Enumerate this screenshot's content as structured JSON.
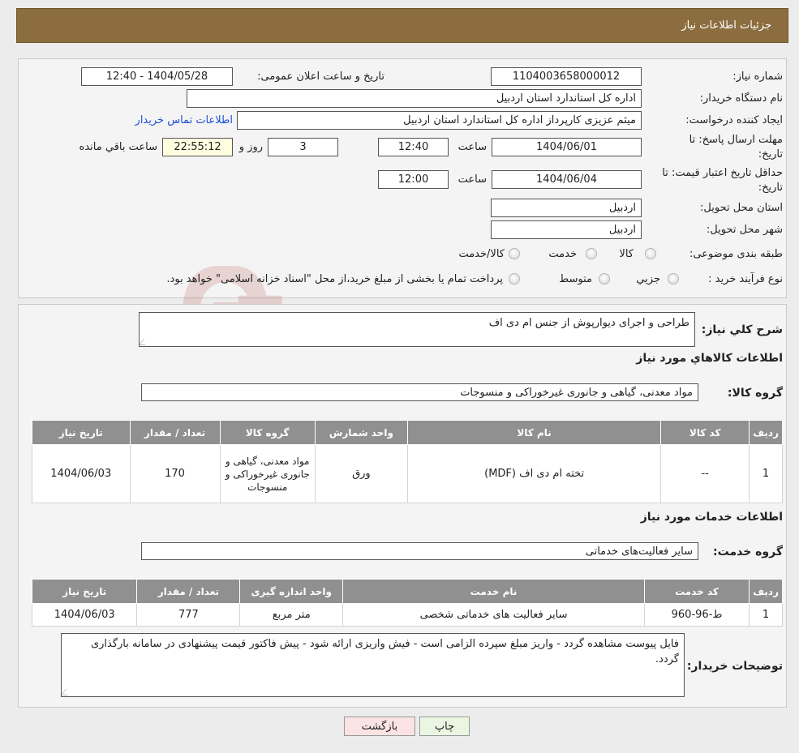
{
  "header": {
    "title": "جزئیات اطلاعات نیاز"
  },
  "form": {
    "need_number_label": "شماره نیاز:",
    "need_number": "1104003658000012",
    "announce_label": "تاریخ و ساعت اعلان عمومی:",
    "announce_value": "1404/05/28 - 12:40",
    "buyer_org_label": "نام دستگاه خریدار:",
    "buyer_org": "اداره کل استاندارد استان اردبیل",
    "creator_label": "ایجاد کننده درخواست:",
    "creator": "میثم عزیزی کارپرداز اداره کل استاندارد استان اردبیل",
    "contact_link": "اطلاعات تماس خریدار",
    "deadline_label_1": "مهلت ارسال پاسخ: تا",
    "deadline_label_2": "تاریخ:",
    "deadline_date": "1404/06/01",
    "time_label": "ساعت",
    "deadline_time": "12:40",
    "days_value": "3",
    "days_label": "روز و",
    "remaining_time": "22:55:12",
    "remaining_label": "ساعت باقي مانده",
    "validity_label_1": "حداقل تاریخ اعتبار قیمت: تا",
    "validity_label_2": "تاریخ:",
    "validity_date": "1404/06/04",
    "validity_time_label": "ساعت",
    "validity_time": "12:00",
    "province_label": "استان محل تحویل:",
    "province": "اردبیل",
    "city_label": "شهر محل تحویل:",
    "city": "اردبیل",
    "category_label": "طبقه بندی موضوعی:",
    "category_options": [
      "کالا",
      "خدمت",
      "کالا/خدمت"
    ],
    "process_label": "نوع فرآیند خرید :",
    "process_options": [
      "جزیي",
      "متوسط"
    ],
    "process_note": "پرداخت تمام یا بخشی از مبلغ خرید،از محل \"اسناد خزانه اسلامی\" خواهد بود."
  },
  "details": {
    "summary_label": "شرح کلي نياز:",
    "summary": "طراحی و اجرای دیوارپوش از جنس ام دی اف",
    "goods_section_title": "اطلاعات کالاهاي مورد نياز",
    "goods_group_label": "گروه کالا:",
    "goods_group": "مواد معدنی، گیاهی و جانوری غیرخوراکی و منسوجات",
    "goods_headers": [
      "رديف",
      "کد کالا",
      "نام کالا",
      "واحد شمارش",
      "گروه کالا",
      "تعداد / مقدار",
      "تاریخ نیاز"
    ],
    "goods_row": {
      "row": "1",
      "code": "--",
      "name": "تخته ام دی اف (MDF)",
      "unit": "ورق",
      "group": "مواد معدنی، گیاهی و جانوری غیرخوراکی و منسوجات",
      "qty": "170",
      "date": "1404/06/03"
    },
    "services_section_title": "اطلاعات خدمات مورد نياز",
    "service_group_label": "گروه خدمت:",
    "service_group": "سایر فعالیت‌های خدماتی",
    "service_headers": [
      "رديف",
      "کد خدمت",
      "نام خدمت",
      "واحد اندازه گیری",
      "تعداد / مقدار",
      "تاریخ نیاز"
    ],
    "service_row": {
      "row": "1",
      "code": "ط-96-960",
      "name": "سایر فعالیت های خدماتی شخصی",
      "unit": "متر مربع",
      "qty": "777",
      "date": "1404/06/03"
    },
    "buyer_notes_label": "توضیحات خریدار:",
    "buyer_notes": "فایل پیوست مشاهده گردد - واریز مبلغ سپرده الزامی است - فیش واریزی ارائه شود - پیش فاکتور قیمت پیشنهادی در سامانه بارگذاری گردد."
  },
  "buttons": {
    "print": "چاپ",
    "back": "بازگشت"
  },
  "watermark": "AriaTender.neT",
  "colors": {
    "header_bg": "#8c6d3f",
    "print_btn": "#eaf6e2",
    "back_btn": "#fbe3e3",
    "link": "#1a4fd6"
  }
}
